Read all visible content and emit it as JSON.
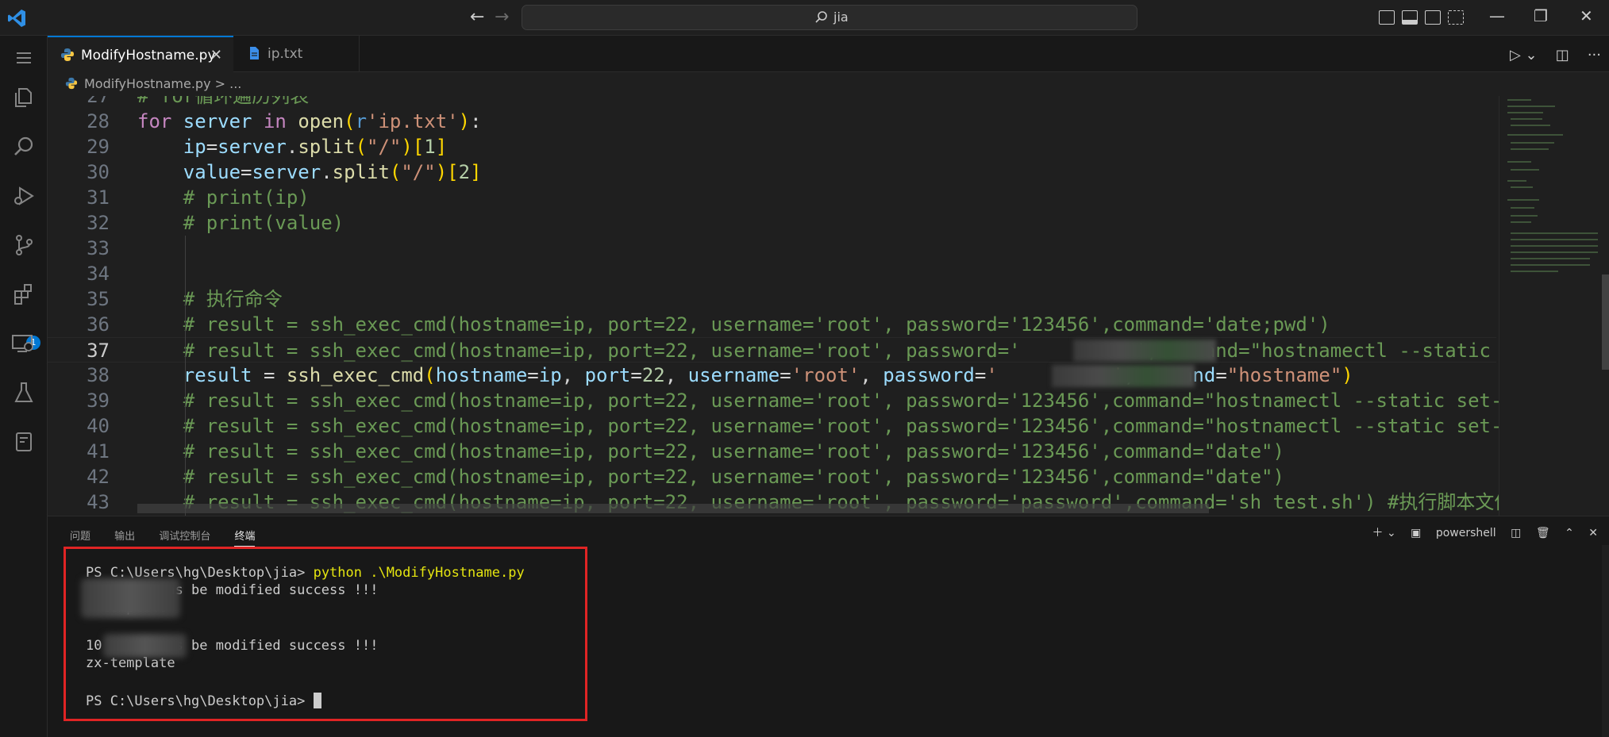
{
  "titlebar": {
    "command_center_text": "jia"
  },
  "tabs": [
    {
      "label": "ModifyHostname.py"
    },
    {
      "label": "ip.txt"
    }
  ],
  "breadcrumb": {
    "file": "ModifyHostname.py",
    "separator": ">",
    "more": "..."
  },
  "activity": {
    "extensions_badge": "1"
  },
  "editor": {
    "lines": [
      {
        "n": "27",
        "segments": [
          {
            "c": "cmt",
            "t": "# for循环遍历列表"
          }
        ]
      },
      {
        "n": "28",
        "segments": [
          {
            "c": "kw",
            "t": "for "
          },
          {
            "c": "var",
            "t": "server "
          },
          {
            "c": "kw",
            "t": "in "
          },
          {
            "c": "fn",
            "t": "open"
          },
          {
            "c": "br1",
            "t": "("
          },
          {
            "c": "pfx",
            "t": "r"
          },
          {
            "c": "str",
            "t": "'ip.txt'"
          },
          {
            "c": "br1",
            "t": ")"
          },
          {
            "c": "plain",
            "t": ":"
          }
        ]
      },
      {
        "n": "29",
        "segments": [
          {
            "c": "plain",
            "t": "    "
          },
          {
            "c": "var",
            "t": "ip"
          },
          {
            "c": "plain",
            "t": "="
          },
          {
            "c": "var",
            "t": "server"
          },
          {
            "c": "plain",
            "t": "."
          },
          {
            "c": "fn",
            "t": "split"
          },
          {
            "c": "br1",
            "t": "("
          },
          {
            "c": "str",
            "t": "\"/\""
          },
          {
            "c": "br1",
            "t": ")"
          },
          {
            "c": "br1",
            "t": "["
          },
          {
            "c": "num",
            "t": "1"
          },
          {
            "c": "br1",
            "t": "]"
          }
        ]
      },
      {
        "n": "30",
        "segments": [
          {
            "c": "plain",
            "t": "    "
          },
          {
            "c": "var",
            "t": "value"
          },
          {
            "c": "plain",
            "t": "="
          },
          {
            "c": "var",
            "t": "server"
          },
          {
            "c": "plain",
            "t": "."
          },
          {
            "c": "fn",
            "t": "split"
          },
          {
            "c": "br1",
            "t": "("
          },
          {
            "c": "str",
            "t": "\"/\""
          },
          {
            "c": "br1",
            "t": ")"
          },
          {
            "c": "br1",
            "t": "["
          },
          {
            "c": "num",
            "t": "2"
          },
          {
            "c": "br1",
            "t": "]"
          }
        ]
      },
      {
        "n": "31",
        "segments": [
          {
            "c": "plain",
            "t": "    "
          },
          {
            "c": "cmt",
            "t": "# print(ip)"
          }
        ]
      },
      {
        "n": "32",
        "segments": [
          {
            "c": "plain",
            "t": "    "
          },
          {
            "c": "cmt",
            "t": "# print(value)"
          }
        ]
      },
      {
        "n": "33",
        "segments": []
      },
      {
        "n": "34",
        "segments": []
      },
      {
        "n": "35",
        "segments": [
          {
            "c": "plain",
            "t": "    "
          },
          {
            "c": "cmt",
            "t": "# 执行命令"
          }
        ]
      },
      {
        "n": "36",
        "segments": [
          {
            "c": "plain",
            "t": "    "
          },
          {
            "c": "cmt",
            "t": "# result = ssh_exec_cmd(hostname=ip, port=22, username='root', password='123456',command='date;pwd')"
          }
        ]
      },
      {
        "n": "37",
        "segments": [
          {
            "c": "plain",
            "t": "    "
          },
          {
            "c": "cmt",
            "t": "# result = ssh_exec_cmd(hostname=ip, port=22, username='root', password='          ',command=\"hostnamectl --static set-hostname \"+value)"
          }
        ]
      },
      {
        "n": "38",
        "segments": [
          {
            "c": "plain",
            "t": "    "
          },
          {
            "c": "var",
            "t": "result "
          },
          {
            "c": "plain",
            "t": "= "
          },
          {
            "c": "fn",
            "t": "ssh_exec_cmd"
          },
          {
            "c": "br1",
            "t": "("
          },
          {
            "c": "var",
            "t": "hostname"
          },
          {
            "c": "plain",
            "t": "="
          },
          {
            "c": "var",
            "t": "ip"
          },
          {
            "c": "plain",
            "t": ", "
          },
          {
            "c": "var",
            "t": "port"
          },
          {
            "c": "plain",
            "t": "="
          },
          {
            "c": "num",
            "t": "22"
          },
          {
            "c": "plain",
            "t": ", "
          },
          {
            "c": "var",
            "t": "username"
          },
          {
            "c": "plain",
            "t": "="
          },
          {
            "c": "str",
            "t": "'root'"
          },
          {
            "c": "plain",
            "t": ", "
          },
          {
            "c": "var",
            "t": "password"
          },
          {
            "c": "plain",
            "t": "="
          },
          {
            "c": "str",
            "t": "'          '"
          },
          {
            "c": "plain",
            "t": ","
          },
          {
            "c": "var",
            "t": "command"
          },
          {
            "c": "plain",
            "t": "="
          },
          {
            "c": "str",
            "t": "\"hostname\""
          },
          {
            "c": "br1",
            "t": ")"
          }
        ]
      },
      {
        "n": "39",
        "segments": [
          {
            "c": "plain",
            "t": "    "
          },
          {
            "c": "cmt",
            "t": "# result = ssh_exec_cmd(hostname=ip, port=22, username='root', password='123456',command=\"hostnamectl --static set-hostname\")"
          }
        ]
      },
      {
        "n": "40",
        "segments": [
          {
            "c": "plain",
            "t": "    "
          },
          {
            "c": "cmt",
            "t": "# result = ssh_exec_cmd(hostname=ip, port=22, username='root', password='123456',command=\"hostnamectl --static set-hostname\")"
          }
        ]
      },
      {
        "n": "41",
        "segments": [
          {
            "c": "plain",
            "t": "    "
          },
          {
            "c": "cmt",
            "t": "# result = ssh_exec_cmd(hostname=ip, port=22, username='root', password='123456',command=\"date\")"
          }
        ]
      },
      {
        "n": "42",
        "segments": [
          {
            "c": "plain",
            "t": "    "
          },
          {
            "c": "cmt",
            "t": "# result = ssh_exec_cmd(hostname=ip, port=22, username='root', password='123456',command=\"date\")"
          }
        ]
      },
      {
        "n": "43",
        "segments": [
          {
            "c": "plain",
            "t": "    "
          },
          {
            "c": "cmt",
            "t": "# result = ssh_exec_cmd(hostname=ip, port=22, username='root', password='password',command='sh test.sh') #执行脚本文件"
          }
        ]
      }
    ]
  },
  "panel": {
    "tabs": [
      "问题",
      "输出",
      "调试控制台",
      "终端"
    ],
    "active_tab": "终端",
    "shell_name": "powershell"
  },
  "terminal": {
    "prompt1": "PS C:\\Users\\hg\\Desktop\\jia> ",
    "command": "python .\\ModifyHostname.py",
    "out1": "          as be modified success !!!",
    "out2": "  template",
    "out3": "10        as be modified success !!!",
    "out4": "zx-template",
    "prompt2": "PS C:\\Users\\hg\\Desktop\\jia> "
  },
  "colors": {
    "accent": "#0078d4",
    "highlight_box": "#e02424"
  }
}
